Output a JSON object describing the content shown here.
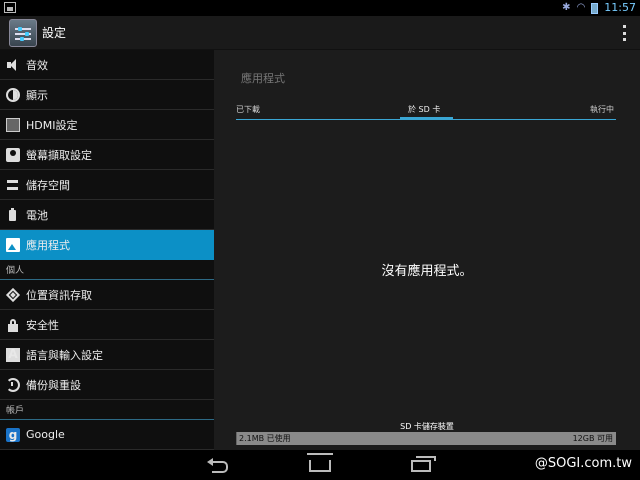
{
  "status_bar": {
    "time": "11:57"
  },
  "action_bar": {
    "title": "設定"
  },
  "sidebar": {
    "items": [
      {
        "label": "音效"
      },
      {
        "label": "顯示"
      },
      {
        "label": "HDMI設定"
      },
      {
        "label": "螢幕擷取設定"
      },
      {
        "label": "儲存空間"
      },
      {
        "label": "電池"
      },
      {
        "label": "應用程式"
      }
    ],
    "section_personal": "個人",
    "personal_items": [
      {
        "label": "位置資訊存取"
      },
      {
        "label": "安全性"
      },
      {
        "label": "語言與輸入設定"
      },
      {
        "label": "備份與重設"
      }
    ],
    "section_accounts": "帳戶",
    "account_items": [
      {
        "label": "Google"
      }
    ],
    "selected": "應用程式"
  },
  "main": {
    "title": "應用程式",
    "tabs": [
      {
        "label": "已下載"
      },
      {
        "label": "於 SD 卡"
      },
      {
        "label": "執行中"
      }
    ],
    "active_tab": "於 SD 卡",
    "empty_message": "沒有應用程式。",
    "storage": {
      "label": "SD 卡儲存裝置",
      "used": "2.1MB 已使用",
      "free": "12GB 可用",
      "used_fraction": 0.0002
    }
  },
  "watermark": "@SOGI.com.tw",
  "colors": {
    "accent": "#0c90c6",
    "tab_indicator": "#3aa6d4"
  }
}
